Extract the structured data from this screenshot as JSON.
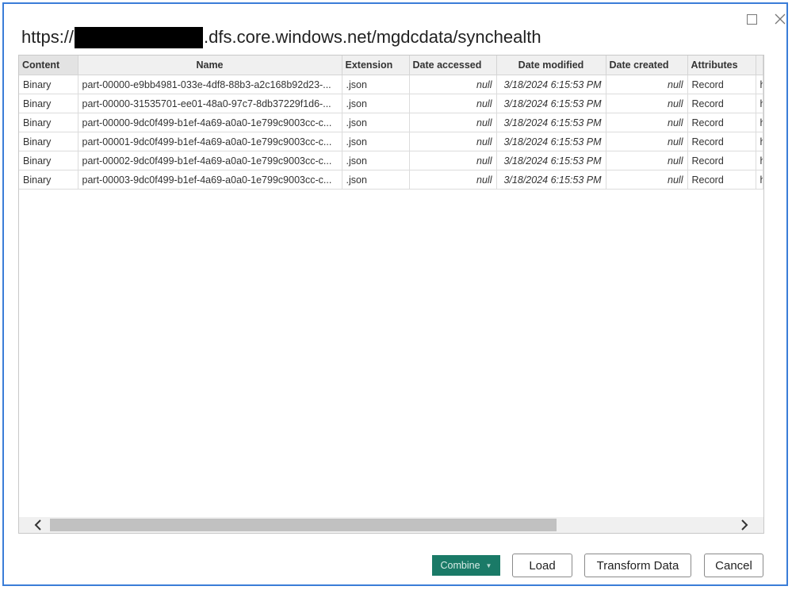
{
  "dialog": {
    "title_prefix": "https://",
    "title_suffix": ".dfs.core.windows.net/mgdcdata/synchealth"
  },
  "table": {
    "columns": [
      "Content",
      "Name",
      "Extension",
      "Date accessed",
      "Date modified",
      "Date created",
      "Attributes"
    ],
    "rows": [
      [
        "Binary",
        "part-00000-e9bb4981-033e-4df8-88b3-a2c168b92d23-...",
        ".json",
        "null",
        "3/18/2024 6:15:53 PM",
        "null",
        "Record",
        "h"
      ],
      [
        "Binary",
        "part-00000-31535701-ee01-48a0-97c7-8db37229f1d6-...",
        ".json",
        "null",
        "3/18/2024 6:15:53 PM",
        "null",
        "Record",
        "h"
      ],
      [
        "Binary",
        "part-00000-9dc0f499-b1ef-4a69-a0a0-1e799c9003cc-c...",
        ".json",
        "null",
        "3/18/2024 6:15:53 PM",
        "null",
        "Record",
        "h"
      ],
      [
        "Binary",
        "part-00001-9dc0f499-b1ef-4a69-a0a0-1e799c9003cc-c...",
        ".json",
        "null",
        "3/18/2024 6:15:53 PM",
        "null",
        "Record",
        "h"
      ],
      [
        "Binary",
        "part-00002-9dc0f499-b1ef-4a69-a0a0-1e799c9003cc-c...",
        ".json",
        "null",
        "3/18/2024 6:15:53 PM",
        "null",
        "Record",
        "h"
      ],
      [
        "Binary",
        "part-00003-9dc0f499-b1ef-4a69-a0a0-1e799c9003cc-c...",
        ".json",
        "null",
        "3/18/2024 6:15:53 PM",
        "null",
        "Record",
        "h"
      ]
    ]
  },
  "footer": {
    "combine_label": "Combine",
    "load_label": "Load",
    "transform_label": "Transform Data",
    "cancel_label": "Cancel"
  },
  "icons": {
    "maximize": "maximize-icon",
    "close": "close-icon",
    "scroll_left": "chevron-left-icon",
    "scroll_right": "chevron-right-icon",
    "dropdown": "caret-down-icon"
  },
  "colors": {
    "accent_border": "#3a7dd8",
    "combine_bg": "#1a7a67"
  }
}
